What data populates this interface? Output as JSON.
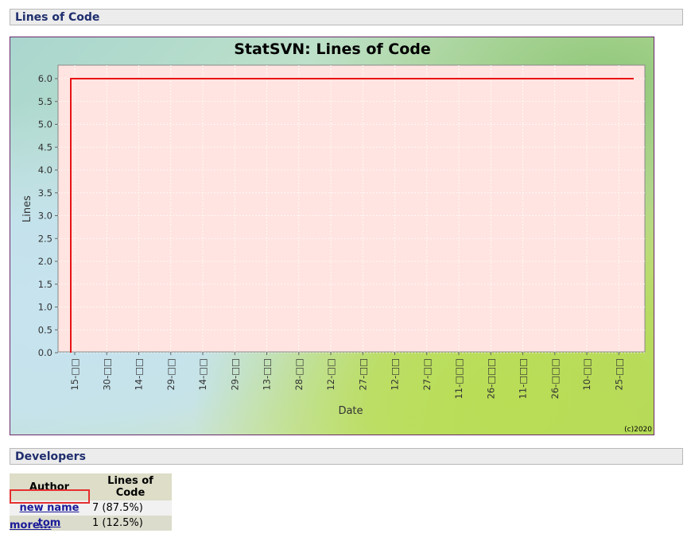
{
  "sections": {
    "loc_title": "Lines of Code",
    "developers_title": "Developers"
  },
  "chart_data": {
    "type": "line",
    "title": "StatSVN: Lines of Code",
    "xlabel": "Date",
    "ylabel": "Lines",
    "ylim": [
      0,
      6.0
    ],
    "yticks": [
      "0.0",
      "0.5",
      "1.0",
      "1.5",
      "2.0",
      "2.5",
      "3.0",
      "3.5",
      "4.0",
      "4.5",
      "5.0",
      "5.5",
      "6.0"
    ],
    "xtick_labels": [
      "15-□□",
      "30-□□",
      "14-□□",
      "29-□□",
      "14-□□",
      "29-□□",
      "13-□□",
      "28-□□",
      "12-□□",
      "27-□□",
      "12-□□",
      "27-□□",
      "11-□□□",
      "26-□□□",
      "11-□□□",
      "26-□□□",
      "10-□□",
      "25-□□"
    ],
    "series": [
      {
        "color": "#e81414",
        "step_points": [
          [
            0,
            0
          ],
          [
            0,
            6
          ],
          [
            1,
            6
          ]
        ]
      }
    ],
    "copyright": "(c)2020",
    "grid": true,
    "plot_background": "#ffe4e1"
  },
  "developers": {
    "headers": [
      "Author",
      "Lines of Code"
    ],
    "rows": [
      {
        "author": "new name",
        "loc": "7 (87.5%)"
      },
      {
        "author": "tom",
        "loc": "1 (12.5%)"
      }
    ],
    "more_label": "more..."
  }
}
